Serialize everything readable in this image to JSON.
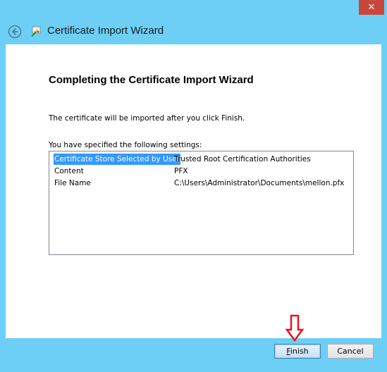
{
  "window": {
    "close_glyph": "✕"
  },
  "header": {
    "title": "Certificate Import Wizard"
  },
  "main": {
    "heading": "Completing the Certificate Import Wizard",
    "description": "The certificate will be imported after you click Finish.",
    "settings_label": "You have specified the following settings:",
    "settings": [
      {
        "key": "Certificate Store Selected by User",
        "value": "Trusted Root Certification Authorities",
        "selected": true
      },
      {
        "key": "Content",
        "value": "PFX",
        "selected": false
      },
      {
        "key": "File Name",
        "value": "C:\\Users\\Administrator\\Documents\\mellon.pfx",
        "selected": false
      }
    ]
  },
  "footer": {
    "finish_first": "F",
    "finish_rest": "inish",
    "cancel_label": "Cancel"
  },
  "colors": {
    "title_bar": "#6dcff6",
    "close_button": "#c7473a",
    "selection": "#3399ff",
    "annotation_arrow": "#e81123"
  }
}
